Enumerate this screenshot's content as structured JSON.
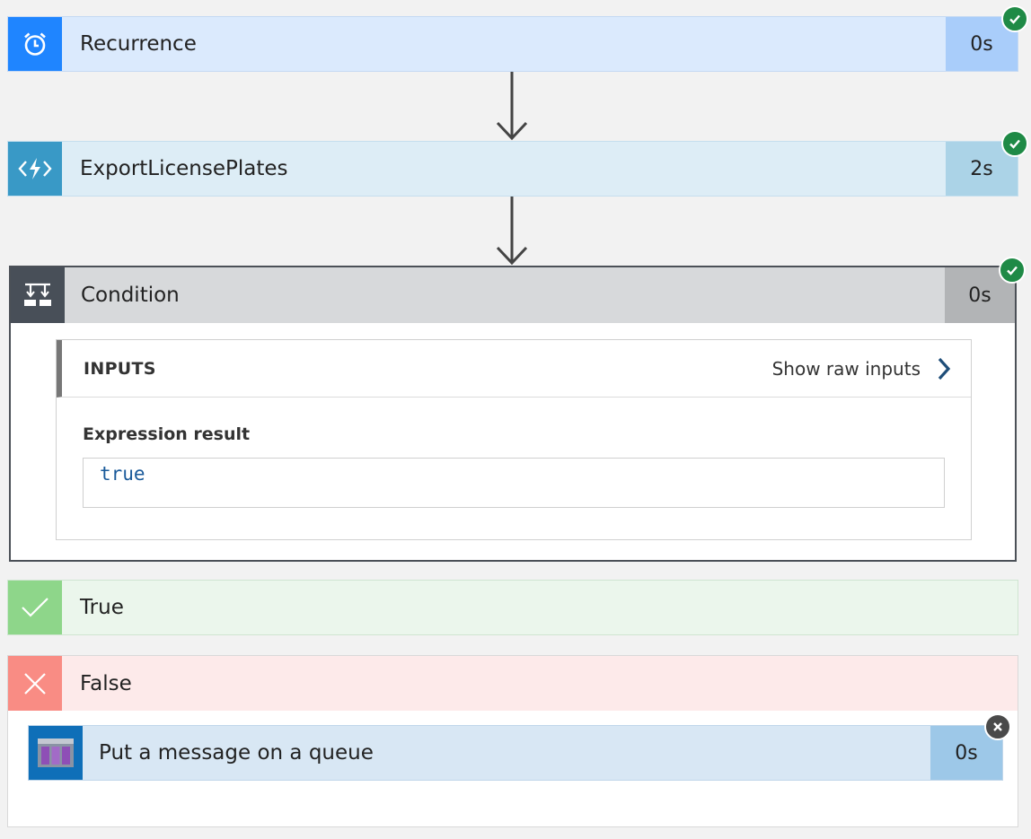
{
  "steps": {
    "recurrence": {
      "title": "Recurrence",
      "duration": "0s",
      "icon": "alarm-clock-icon",
      "status": "succeeded"
    },
    "export": {
      "title": "ExportLicensePlates",
      "duration": "2s",
      "icon": "azure-function-icon",
      "status": "succeeded"
    },
    "condition": {
      "title": "Condition",
      "duration": "0s",
      "icon": "condition-icon",
      "status": "succeeded",
      "inputs": {
        "header": "INPUTS",
        "show_raw": "Show raw inputs",
        "expression_label": "Expression result",
        "expression_value": "true"
      }
    },
    "true_branch": {
      "title": "True",
      "icon": "checkmark-icon"
    },
    "false_branch": {
      "title": "False",
      "icon": "x-icon",
      "queue": {
        "title": "Put a message on a queue",
        "duration": "0s",
        "icon": "storage-queue-icon",
        "status": "failed"
      }
    }
  },
  "colors": {
    "success": "#1f8a46",
    "failed": "#4a4a4a",
    "recurrence_accent": "#1f85ff",
    "function_accent": "#3999c6",
    "condition_accent": "#484f58",
    "true_accent": "#8ed68a",
    "false_accent": "#f98c84",
    "queue_accent": "#0f6fb8"
  }
}
